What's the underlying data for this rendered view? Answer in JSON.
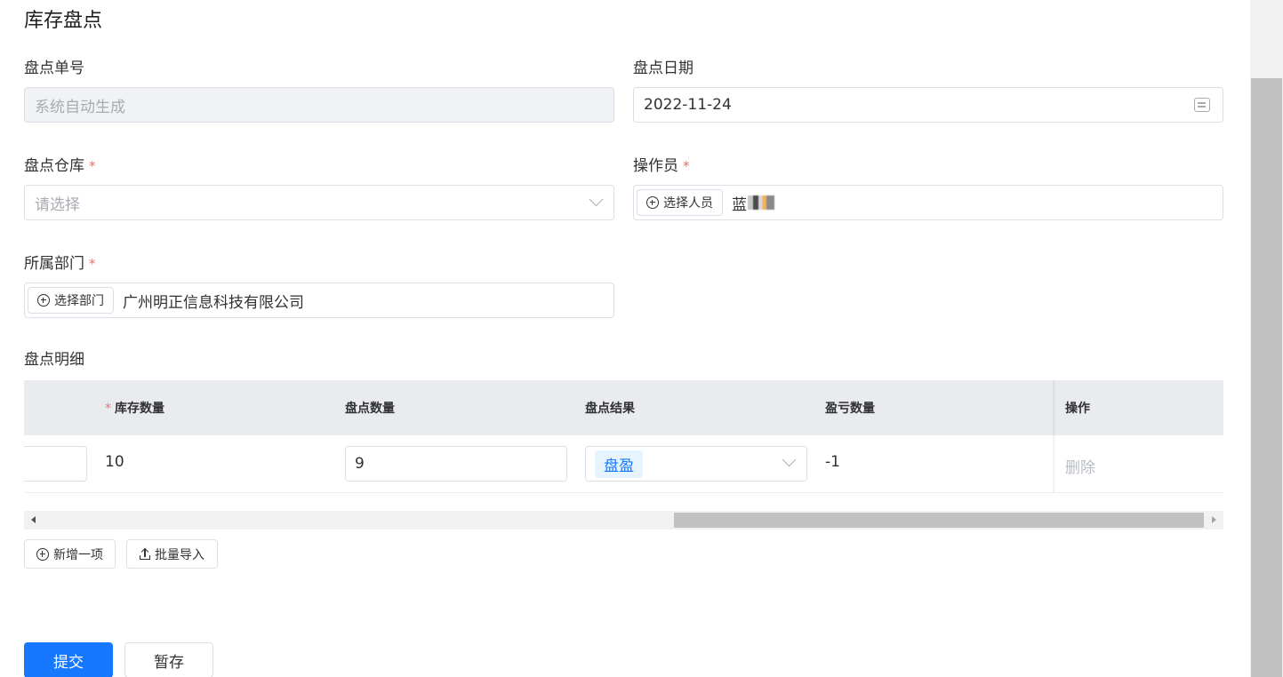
{
  "page": {
    "title": "库存盘点"
  },
  "form": {
    "order_no": {
      "label": "盘点单号",
      "placeholder": "系统自动生成"
    },
    "date": {
      "label": "盘点日期",
      "value": "2022-11-24"
    },
    "warehouse": {
      "label": "盘点仓库",
      "required": "*",
      "placeholder": "请选择"
    },
    "operator": {
      "label": "操作员",
      "required": "*",
      "button": "选择人员",
      "value": "蓝"
    },
    "department": {
      "label": "所属部门",
      "required": "*",
      "button": "选择部门",
      "value": "广州明正信息科技有限公司"
    }
  },
  "detail": {
    "title": "盘点明细",
    "columns": {
      "stock_qty": {
        "required": "*",
        "label": "库存数量"
      },
      "count_qty": {
        "label": "盘点数量"
      },
      "result": {
        "label": "盘点结果"
      },
      "diff_qty": {
        "label": "盈亏数量"
      },
      "action": {
        "label": "操作"
      }
    },
    "rows": [
      {
        "stock_qty": "10",
        "count_qty": "9",
        "result": "盘盈",
        "diff_qty": "-1",
        "action": "删除"
      }
    ],
    "horizontal_scroll_fraction": 1.0
  },
  "actions": {
    "add_item": "新增一项",
    "batch_import": "批量导入",
    "submit": "提交",
    "save_draft": "暂存"
  },
  "colors": {
    "primary": "#1677ff",
    "required": "#f56c6c",
    "tag_bg": "#e6f4ff",
    "table_header_bg": "#e9ebee"
  }
}
